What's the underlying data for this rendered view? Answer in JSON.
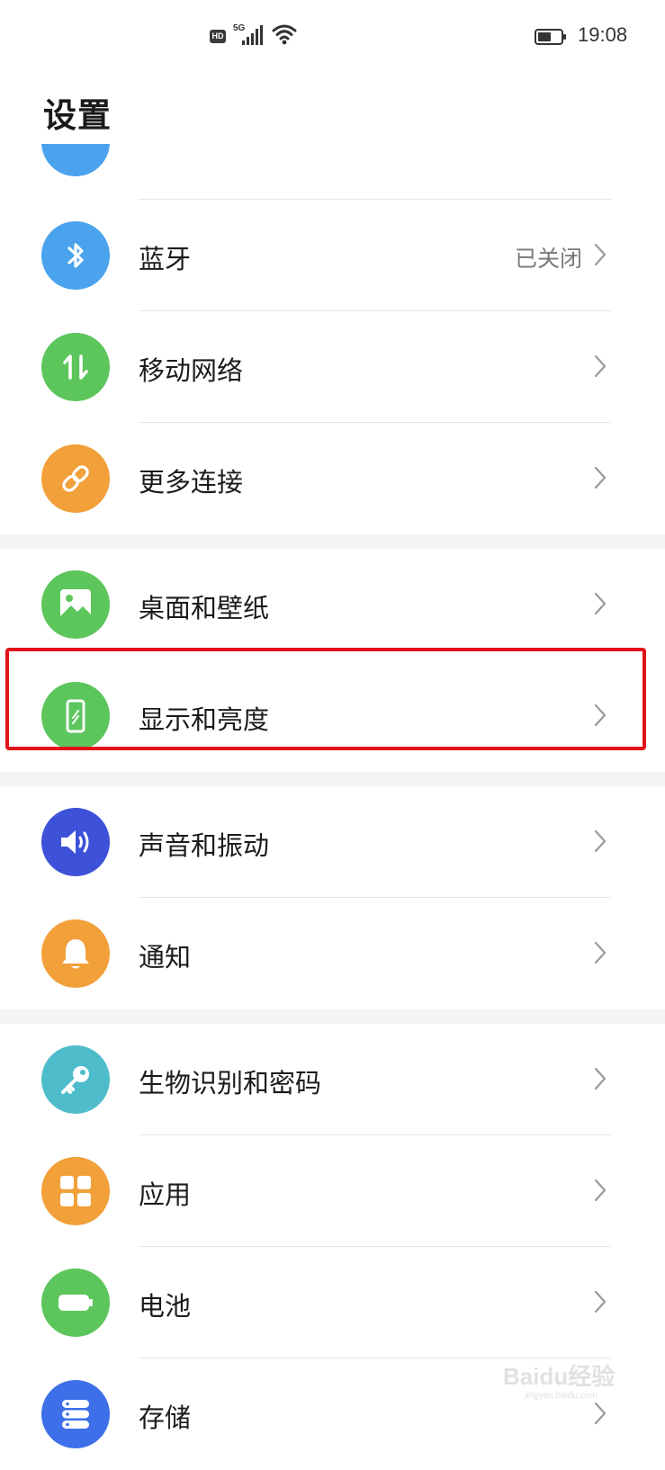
{
  "status_bar": {
    "hd": "HD",
    "network": "5G",
    "time": "19:08"
  },
  "page": {
    "title": "设置"
  },
  "colors": {
    "blue": "#4aa3ec",
    "green": "#5cc65c",
    "orange": "#f2a039",
    "indigo": "#3d52d9",
    "teal": "#4fbccb",
    "highlight": "#e1121a"
  },
  "items": [
    {
      "label": "蓝牙",
      "value": "已关闭",
      "icon": "bluetooth-icon"
    },
    {
      "label": "移动网络",
      "icon": "mobile-data-icon"
    },
    {
      "label": "更多连接",
      "icon": "link-icon"
    },
    {
      "label": "桌面和壁纸",
      "icon": "wallpaper-icon"
    },
    {
      "label": "显示和亮度",
      "icon": "display-icon"
    },
    {
      "label": "声音和振动",
      "icon": "speaker-icon"
    },
    {
      "label": "通知",
      "icon": "bell-icon"
    },
    {
      "label": "生物识别和密码",
      "icon": "key-icon"
    },
    {
      "label": "应用",
      "icon": "apps-grid-icon"
    },
    {
      "label": "电池",
      "icon": "battery-icon"
    },
    {
      "label": "存储",
      "icon": "storage-icon"
    }
  ],
  "watermark": {
    "text": "Baidu经验",
    "sub": "jingyan.baidu.com"
  }
}
